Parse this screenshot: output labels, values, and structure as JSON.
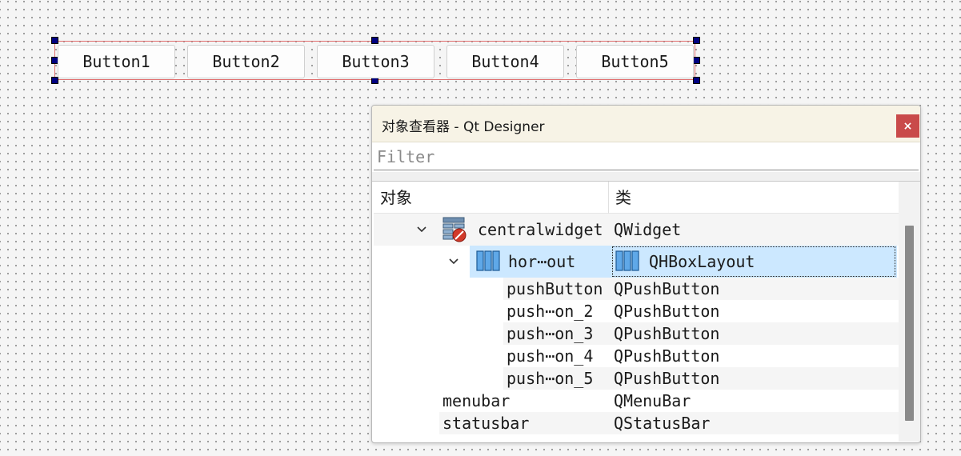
{
  "canvas": {
    "buttons": [
      "Button1",
      "Button2",
      "Button3",
      "Button4",
      "Button5"
    ]
  },
  "inspector": {
    "title": "对象查看器 - Qt Designer",
    "close_label": "×",
    "filter_placeholder": "Filter",
    "columns": {
      "object": "对象",
      "class": "类"
    },
    "rows": {
      "centralwidget": {
        "name": "centralwidget",
        "cls": "QWidget",
        "icon": "widget-icon"
      },
      "horizontal_layout": {
        "name": "hor⋯out",
        "cls": "QHBoxLayout",
        "icon": "hbox-layout-icon"
      },
      "push1": {
        "name": "pushButton",
        "cls": "QPushButton"
      },
      "push2": {
        "name": "push⋯on_2",
        "cls": "QPushButton"
      },
      "push3": {
        "name": "push⋯on_3",
        "cls": "QPushButton"
      },
      "push4": {
        "name": "push⋯on_4",
        "cls": "QPushButton"
      },
      "push5": {
        "name": "push⋯on_5",
        "cls": "QPushButton"
      },
      "menubar": {
        "name": "menubar",
        "cls": "QMenuBar"
      },
      "statusbar": {
        "name": "statusbar",
        "cls": "QStatusBar"
      }
    }
  },
  "colors": {
    "selection": "#cce8ff",
    "layout_border": "#e07070",
    "handle": "#000080",
    "close_button": "#c94a4a",
    "titlebar": "#f7f3e6"
  }
}
